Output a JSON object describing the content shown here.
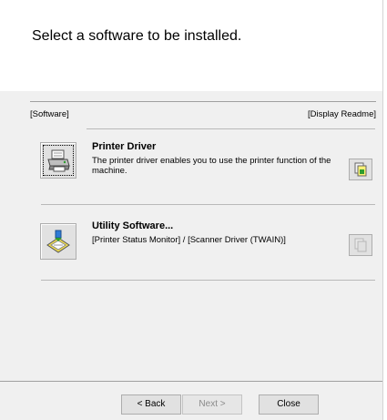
{
  "header": {
    "title": "Select a software to be installed."
  },
  "list": {
    "software_column_label": "[Software]",
    "readme_column_label": "[Display Readme]",
    "items": [
      {
        "title": "Printer Driver",
        "description": "The printer driver enables you to use the printer function of the machine.",
        "icon": "printer-driver-icon",
        "readme_enabled": true
      },
      {
        "title": "Utility Software...",
        "description": "[Printer Status Monitor] / [Scanner Driver (TWAIN)]",
        "icon": "utility-software-icon",
        "readme_enabled": false
      }
    ]
  },
  "footer": {
    "back_label": "< Back",
    "next_label": "Next >",
    "close_label": "Close"
  }
}
